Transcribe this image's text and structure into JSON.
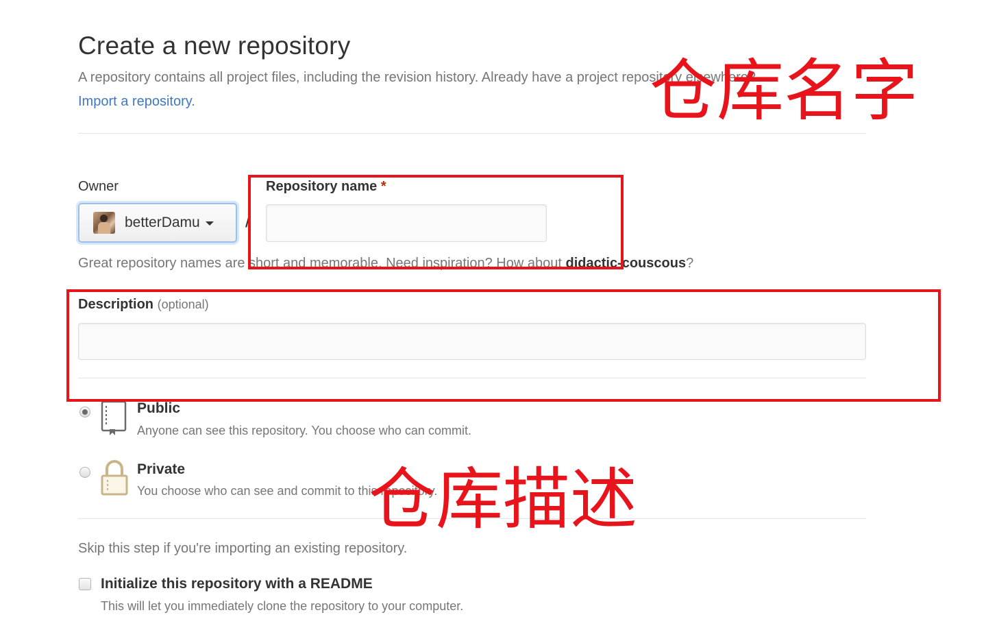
{
  "header": {
    "title": "Create a new repository",
    "subtitle": "A repository contains all project files, including the revision history. Already have a project repository elsewhere?",
    "import_link": "Import a repository",
    "import_period": "."
  },
  "owner": {
    "label": "Owner",
    "value": "betterDamu"
  },
  "separator": "/",
  "repo_name": {
    "label": "Repository name",
    "required_mark": "*",
    "value": "",
    "hint_prefix": "Great repository names are short and memorable. Need inspiration? How about ",
    "hint_suggestion": "didactic-couscous",
    "hint_suffix": "?"
  },
  "description": {
    "label": "Description",
    "optional": "(optional)",
    "value": ""
  },
  "visibility": {
    "public": {
      "title": "Public",
      "desc": "Anyone can see this repository. You choose who can commit.",
      "checked": true
    },
    "private": {
      "title": "Private",
      "desc": "You choose who can see and commit to this repository.",
      "checked": false
    }
  },
  "init": {
    "skip_text": "Skip this step if you're importing an existing repository.",
    "readme_label": "Initialize this repository with a README",
    "readme_desc": "This will let you immediately clone the repository to your computer.",
    "checked": false
  },
  "annotations": {
    "repo_name_note": "仓库名字",
    "description_note": "仓库描述",
    "color": "#e8141c"
  },
  "colors": {
    "link": "#4078c0",
    "required": "#bd2c00",
    "muted": "#767676"
  }
}
